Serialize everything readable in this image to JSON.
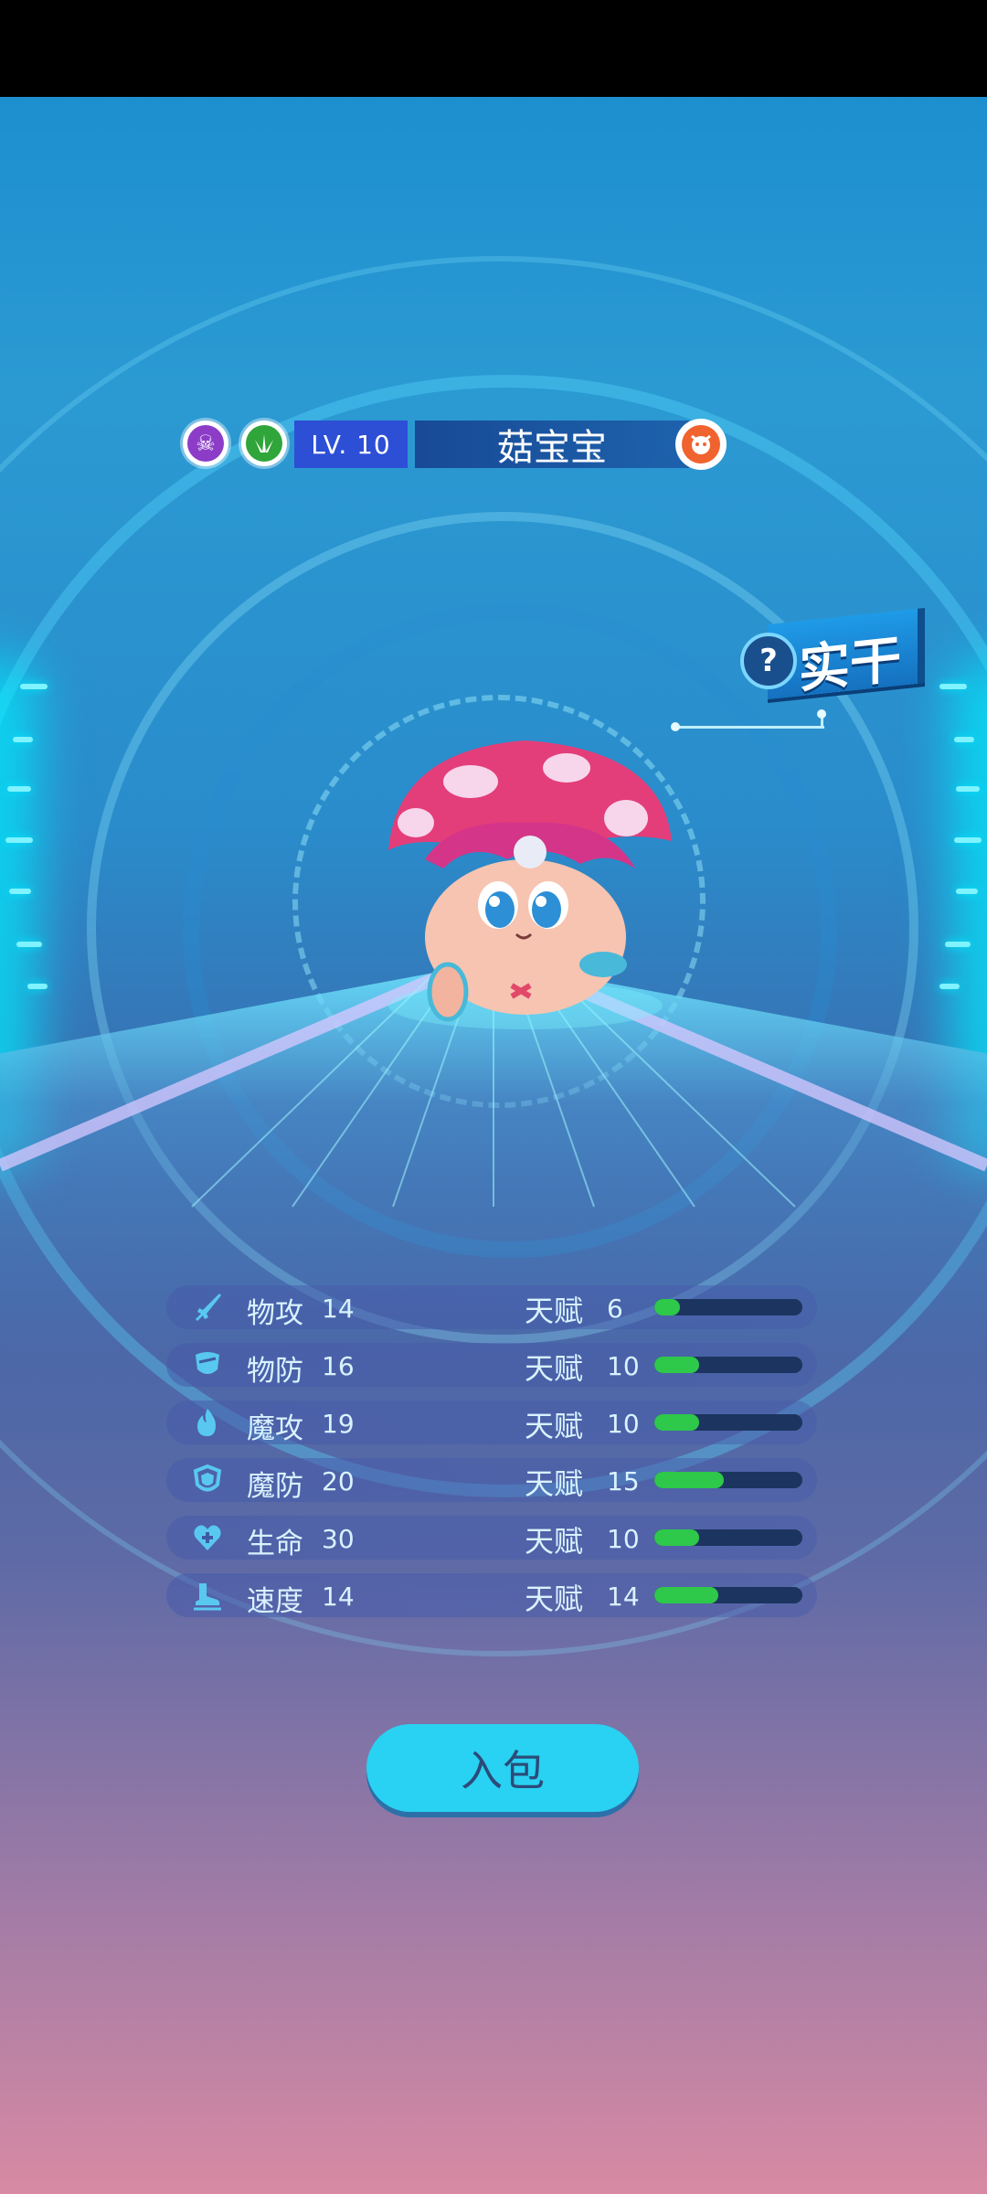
{
  "pet": {
    "level": "LV. 10",
    "name": "菇宝宝",
    "nature": "实干",
    "nature_hint": "?",
    "attribute_icons": [
      "poison-skull-icon",
      "grass-icon"
    ]
  },
  "stats": [
    {
      "name": "物攻",
      "value": "14",
      "talent_label": "天赋",
      "talent": "6",
      "talent_fraction": 0.17,
      "icon": "sword-icon"
    },
    {
      "name": "物防",
      "value": "16",
      "talent_label": "天赋",
      "talent": "10",
      "talent_fraction": 0.3,
      "icon": "shield-icon"
    },
    {
      "name": "魔攻",
      "value": "19",
      "talent_label": "天赋",
      "talent": "10",
      "talent_fraction": 0.3,
      "icon": "flame-icon"
    },
    {
      "name": "魔防",
      "value": "20",
      "talent_label": "天赋",
      "talent": "15",
      "talent_fraction": 0.47,
      "icon": "magic-shield-icon"
    },
    {
      "name": "生命",
      "value": "30",
      "talent_label": "天赋",
      "talent": "10",
      "talent_fraction": 0.3,
      "icon": "heart-plus-icon"
    },
    {
      "name": "速度",
      "value": "14",
      "talent_label": "天赋",
      "talent": "14",
      "talent_fraction": 0.43,
      "icon": "boot-icon"
    }
  ],
  "actions": {
    "bag_label": "入包"
  },
  "colors": {
    "talent_bar": "#2ec84a",
    "button": "#29d1f2",
    "level_box": "#2d4fd6"
  }
}
